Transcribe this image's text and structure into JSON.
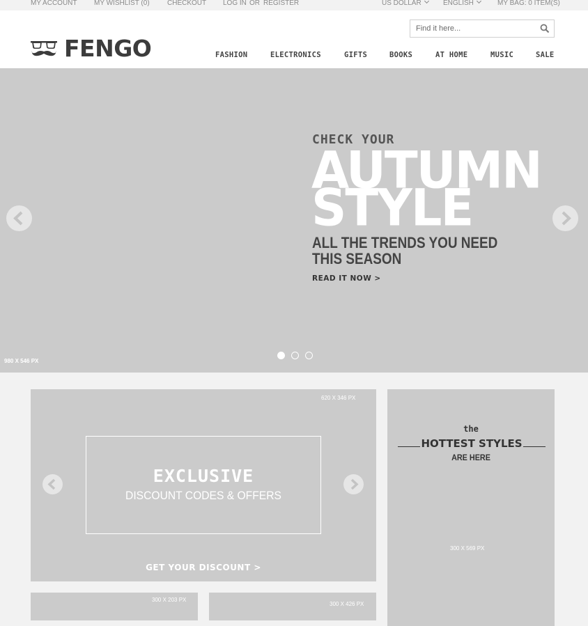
{
  "topbar": {
    "my_account": "MY ACCOUNT",
    "my_wishlist": "MY WISHLIST (0)",
    "checkout": "CHECKOUT",
    "log_in": "LOG IN",
    "or": "OR",
    "register": "REGISTER",
    "currency": "US DOLLAR",
    "language": "ENGLISH",
    "bag": "MY BAG: 0 ITEM(S)"
  },
  "header": {
    "logo_text": "FENGO",
    "search_placeholder": "Find it here...",
    "nav": [
      "FASHION",
      "ELECTRONICS",
      "GIFTS",
      "BOOKS",
      "AT HOME",
      "MUSIC",
      "SALE"
    ]
  },
  "hero": {
    "kicker": "CHECK YOUR",
    "title_line1": "AUTUMN",
    "title_line2": "STYLE",
    "subtitle_line1": "ALL THE TRENDS YOU NEED",
    "subtitle_line2": "THIS SEASON",
    "cta": "READ IT NOW >",
    "size_label": "980 X 546 PX",
    "active_slide": 1,
    "slide_count": 3
  },
  "promo_main": {
    "size_label": "620 X 346 PX",
    "title": "EXCLUSIVE",
    "subtitle": "DISCOUNT CODES & OFFERS",
    "cta": "GET YOUR DISCOUNT >"
  },
  "promo_tall": {
    "the": "the",
    "title": "HOTTEST STYLES",
    "subtitle": "ARE HERE",
    "size_label": "300 X 569 PX"
  },
  "promo_small1": {
    "size_label": "300 X 203 PX"
  },
  "promo_small2": {
    "size_label": "300 X 426 PX"
  },
  "colors": {
    "placeholder_gray": "#cbcbcb",
    "page_bg": "#f2f2f2",
    "text_dark": "#3c3c3c"
  }
}
